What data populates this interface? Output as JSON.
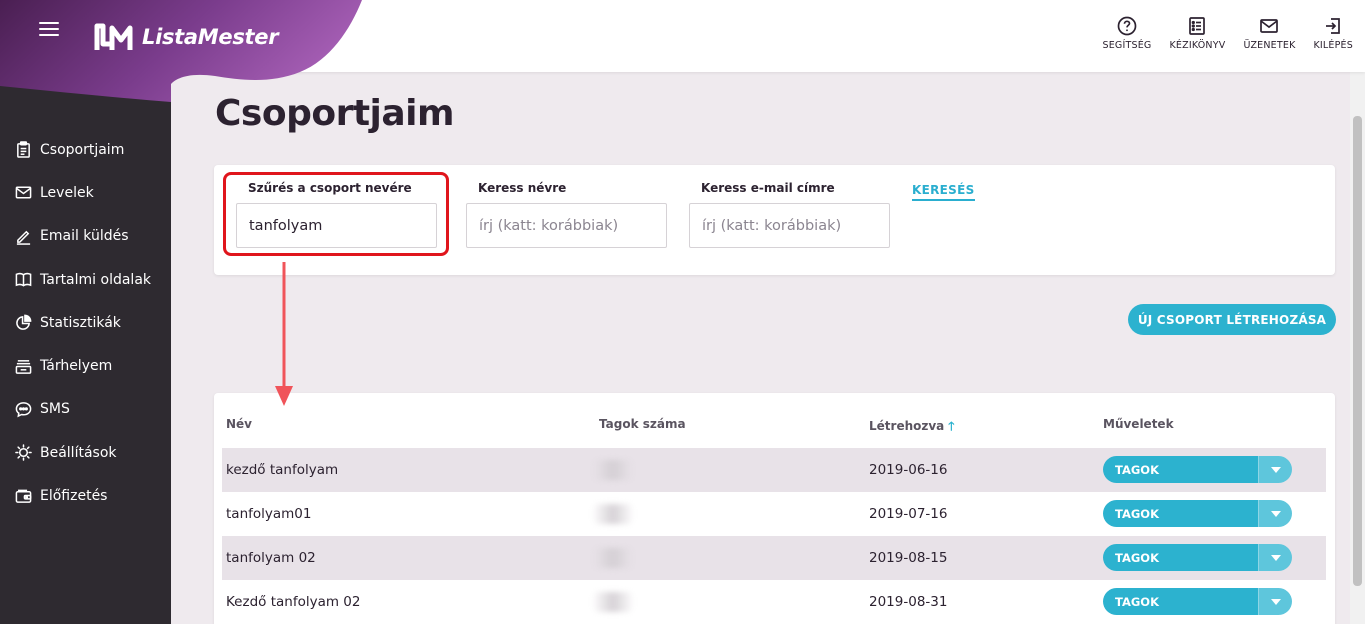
{
  "brand": {
    "name": "ListaMester"
  },
  "sidebar": {
    "items": [
      {
        "label": "Csoportjaim",
        "icon": "clipboard-icon"
      },
      {
        "label": "Levelek",
        "icon": "envelope-icon"
      },
      {
        "label": "Email küldés",
        "icon": "pencil-icon"
      },
      {
        "label": "Tartalmi oldalak",
        "icon": "book-icon"
      },
      {
        "label": "Statisztikák",
        "icon": "pie-chart-icon"
      },
      {
        "label": "Tárhelyem",
        "icon": "storage-icon"
      },
      {
        "label": "SMS",
        "icon": "chat-icon"
      },
      {
        "label": "Beállítások",
        "icon": "gear-icon"
      },
      {
        "label": "Előfizetés",
        "icon": "wallet-icon"
      }
    ]
  },
  "topbar": {
    "help": "SEGÍTSÉG",
    "manual": "KÉZIKÖNYV",
    "messages": "ÜZENETEK",
    "logout": "KILÉPÉS"
  },
  "page": {
    "title": "Csoportjaim"
  },
  "filters": {
    "group_name": {
      "label": "Szűrés a csoport nevére",
      "value": "tanfolyam"
    },
    "name": {
      "label": "Keress névre",
      "placeholder": "írj (katt: korábbiak)"
    },
    "email": {
      "label": "Keress e-mail címre",
      "placeholder": "írj (katt: korábbiak)"
    },
    "search_label": "KERESÉS"
  },
  "new_group_button": "ÚJ CSOPORT LÉTREHOZÁSA",
  "table": {
    "headers": {
      "name": "Név",
      "members": "Tagok száma",
      "created": "Létrehozva",
      "actions": "Műveletek"
    },
    "rows": [
      {
        "name": "kezdő tanfolyam",
        "created": "2019-06-16",
        "action": "TAGOK"
      },
      {
        "name": "tanfolyam01",
        "created": "2019-07-16",
        "action": "TAGOK"
      },
      {
        "name": "tanfolyam 02",
        "created": "2019-08-15",
        "action": "TAGOK"
      },
      {
        "name": "Kezdő tanfolyam 02",
        "created": "2019-08-31",
        "action": "TAGOK"
      }
    ]
  },
  "colors": {
    "accent": "#2cb2cf",
    "sidebar": "#2e2a30",
    "brand_purple": "#7a3c8c",
    "highlight": "#e0151c"
  }
}
